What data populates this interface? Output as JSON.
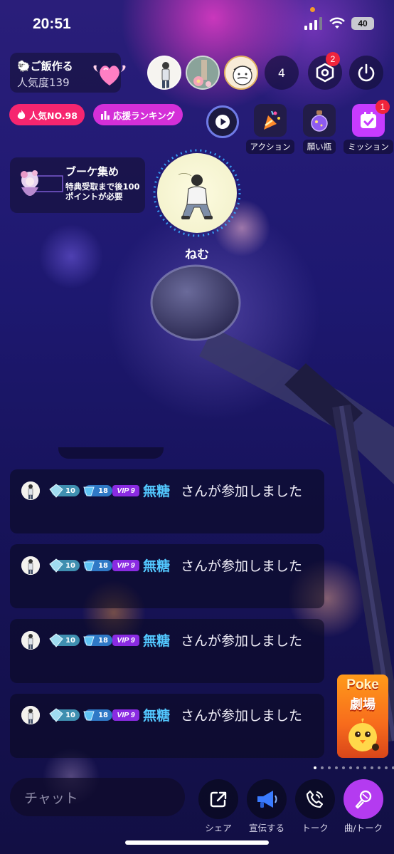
{
  "status": {
    "time": "20:51",
    "battery": "40"
  },
  "room": {
    "title": "🐑ご飯作る",
    "popularity": "人気度139"
  },
  "audience": {
    "count": "4"
  },
  "badges": {
    "settings": "2",
    "mission": "1"
  },
  "pills": {
    "rank": "人気NO.98",
    "support": "応援ランキング"
  },
  "tools": [
    {
      "label": "アクション",
      "icon": "party-popper-icon"
    },
    {
      "label": "願い瓶",
      "icon": "wish-bottle-icon"
    },
    {
      "label": "ミッション",
      "icon": "calendar-check-icon"
    }
  ],
  "bouquet": {
    "title": "ブーケ集め",
    "desc": "特典受取まで後100ポイントが必要"
  },
  "host": {
    "name": "ねむ"
  },
  "messages": [
    {
      "lvl1": "10",
      "lvl2": "18",
      "vip": "VIP 9",
      "user": "無糖",
      "text": "さんが参加しました"
    },
    {
      "lvl1": "10",
      "lvl2": "18",
      "vip": "VIP 9",
      "user": "無糖",
      "text": "さんが参加しました"
    },
    {
      "lvl1": "10",
      "lvl2": "18",
      "vip": "VIP 9",
      "user": "無糖",
      "text": "さんが参加しました"
    },
    {
      "lvl1": "10",
      "lvl2": "18",
      "vip": "VIP 9",
      "user": "無糖",
      "text": "さんが参加しました"
    }
  ],
  "promo": {
    "title": "Poke",
    "sub": "劇場"
  },
  "chat": {
    "placeholder": "チャット"
  },
  "bottom": {
    "share": "シェア",
    "promote": "宣伝する",
    "talk": "トーク",
    "song": "曲/トーク"
  },
  "colors": {
    "accent": "#b43bf0",
    "username": "#53c8ff",
    "rank_pill": "#f6256f",
    "support_pill": "#d42fd8",
    "badge": "#f0243c"
  }
}
